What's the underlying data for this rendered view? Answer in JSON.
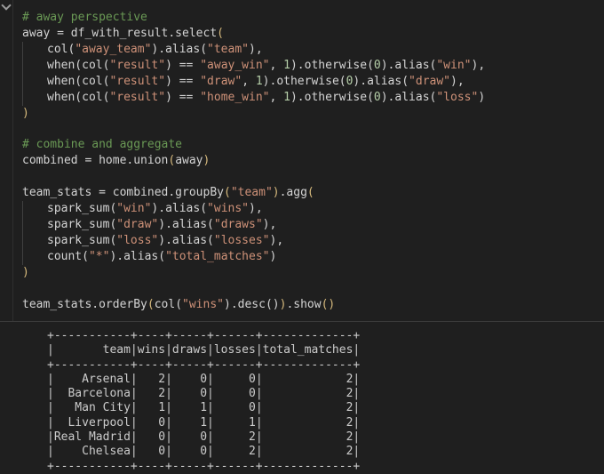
{
  "code_lines": [
    {
      "indent": 0,
      "segments": [
        {
          "t": "# away perspective",
          "c": "c"
        }
      ]
    },
    {
      "indent": 0,
      "segments": [
        {
          "t": "away = df_with_result.select",
          "c": "o"
        },
        {
          "t": "(",
          "c": "p"
        }
      ]
    },
    {
      "indent": 1,
      "segments": [
        {
          "t": "col(",
          "c": "o"
        },
        {
          "t": "\"away_team\"",
          "c": "s"
        },
        {
          "t": ").alias(",
          "c": "o"
        },
        {
          "t": "\"team\"",
          "c": "s"
        },
        {
          "t": "),",
          "c": "o"
        }
      ]
    },
    {
      "indent": 1,
      "segments": [
        {
          "t": "when(col(",
          "c": "o"
        },
        {
          "t": "\"result\"",
          "c": "s"
        },
        {
          "t": ") == ",
          "c": "o"
        },
        {
          "t": "\"away_win\"",
          "c": "s"
        },
        {
          "t": ", ",
          "c": "o"
        },
        {
          "t": "1",
          "c": "n"
        },
        {
          "t": ").otherwise(",
          "c": "o"
        },
        {
          "t": "0",
          "c": "n"
        },
        {
          "t": ").alias(",
          "c": "o"
        },
        {
          "t": "\"win\"",
          "c": "s"
        },
        {
          "t": "),",
          "c": "o"
        }
      ]
    },
    {
      "indent": 1,
      "segments": [
        {
          "t": "when(col(",
          "c": "o"
        },
        {
          "t": "\"result\"",
          "c": "s"
        },
        {
          "t": ") == ",
          "c": "o"
        },
        {
          "t": "\"draw\"",
          "c": "s"
        },
        {
          "t": ", ",
          "c": "o"
        },
        {
          "t": "1",
          "c": "n"
        },
        {
          "t": ").otherwise(",
          "c": "o"
        },
        {
          "t": "0",
          "c": "n"
        },
        {
          "t": ").alias(",
          "c": "o"
        },
        {
          "t": "\"draw\"",
          "c": "s"
        },
        {
          "t": "),",
          "c": "o"
        }
      ]
    },
    {
      "indent": 1,
      "segments": [
        {
          "t": "when(col(",
          "c": "o"
        },
        {
          "t": "\"result\"",
          "c": "s"
        },
        {
          "t": ") == ",
          "c": "o"
        },
        {
          "t": "\"home_win\"",
          "c": "s"
        },
        {
          "t": ", ",
          "c": "o"
        },
        {
          "t": "1",
          "c": "n"
        },
        {
          "t": ").otherwise(",
          "c": "o"
        },
        {
          "t": "0",
          "c": "n"
        },
        {
          "t": ").alias(",
          "c": "o"
        },
        {
          "t": "\"loss\"",
          "c": "s"
        },
        {
          "t": ")",
          "c": "o"
        }
      ]
    },
    {
      "indent": 0,
      "segments": [
        {
          "t": ")",
          "c": "p"
        }
      ]
    },
    {
      "indent": 0,
      "segments": []
    },
    {
      "indent": 0,
      "segments": [
        {
          "t": "# combine and aggregate",
          "c": "c"
        }
      ]
    },
    {
      "indent": 0,
      "segments": [
        {
          "t": "combined = home.union",
          "c": "o"
        },
        {
          "t": "(",
          "c": "p"
        },
        {
          "t": "away",
          "c": "o"
        },
        {
          "t": ")",
          "c": "p"
        }
      ]
    },
    {
      "indent": 0,
      "segments": []
    },
    {
      "indent": 0,
      "segments": [
        {
          "t": "team_stats = combined.groupBy",
          "c": "o"
        },
        {
          "t": "(",
          "c": "p"
        },
        {
          "t": "\"team\"",
          "c": "s"
        },
        {
          "t": ")",
          "c": "p"
        },
        {
          "t": ".agg",
          "c": "o"
        },
        {
          "t": "(",
          "c": "p"
        }
      ]
    },
    {
      "indent": 1,
      "segments": [
        {
          "t": "spark_sum(",
          "c": "o"
        },
        {
          "t": "\"win\"",
          "c": "s"
        },
        {
          "t": ").alias(",
          "c": "o"
        },
        {
          "t": "\"wins\"",
          "c": "s"
        },
        {
          "t": "),",
          "c": "o"
        }
      ]
    },
    {
      "indent": 1,
      "segments": [
        {
          "t": "spark_sum(",
          "c": "o"
        },
        {
          "t": "\"draw\"",
          "c": "s"
        },
        {
          "t": ").alias(",
          "c": "o"
        },
        {
          "t": "\"draws\"",
          "c": "s"
        },
        {
          "t": "),",
          "c": "o"
        }
      ]
    },
    {
      "indent": 1,
      "segments": [
        {
          "t": "spark_sum(",
          "c": "o"
        },
        {
          "t": "\"loss\"",
          "c": "s"
        },
        {
          "t": ").alias(",
          "c": "o"
        },
        {
          "t": "\"losses\"",
          "c": "s"
        },
        {
          "t": "),",
          "c": "o"
        }
      ]
    },
    {
      "indent": 1,
      "segments": [
        {
          "t": "count(",
          "c": "o"
        },
        {
          "t": "\"*\"",
          "c": "s"
        },
        {
          "t": ").alias(",
          "c": "o"
        },
        {
          "t": "\"total_matches\"",
          "c": "s"
        },
        {
          "t": ")",
          "c": "o"
        }
      ]
    },
    {
      "indent": 0,
      "segments": [
        {
          "t": ")",
          "c": "p"
        }
      ]
    },
    {
      "indent": 0,
      "segments": []
    },
    {
      "indent": 0,
      "segments": [
        {
          "t": "team_stats.orderBy",
          "c": "o"
        },
        {
          "t": "(",
          "c": "p"
        },
        {
          "t": "col(",
          "c": "o"
        },
        {
          "t": "\"wins\"",
          "c": "s"
        },
        {
          "t": ").desc()",
          "c": "o"
        },
        {
          "t": ")",
          "c": "p"
        },
        {
          "t": ".show",
          "c": "o"
        },
        {
          "t": "()",
          "c": "p"
        }
      ]
    }
  ],
  "output_table": {
    "columns": [
      "team",
      "wins",
      "draws",
      "losses",
      "total_matches"
    ],
    "rows": [
      [
        "Arsenal",
        "2",
        "0",
        "0",
        "2"
      ],
      [
        "Barcelona",
        "2",
        "0",
        "0",
        "2"
      ],
      [
        "Man City",
        "1",
        "1",
        "0",
        "2"
      ],
      [
        "Liverpool",
        "0",
        "1",
        "1",
        "2"
      ],
      [
        "Real Madrid",
        "0",
        "0",
        "2",
        "2"
      ],
      [
        "Chelsea",
        "0",
        "0",
        "2",
        "2"
      ]
    ]
  },
  "colors": {
    "background": "#1f1f1f",
    "text": "#cccccc",
    "comment": "#6a9955",
    "string": "#ce9178",
    "number": "#b5cea8",
    "bracket": "#d7ba7d"
  },
  "icons": {
    "gutter": "collapse-chevron-icon"
  }
}
